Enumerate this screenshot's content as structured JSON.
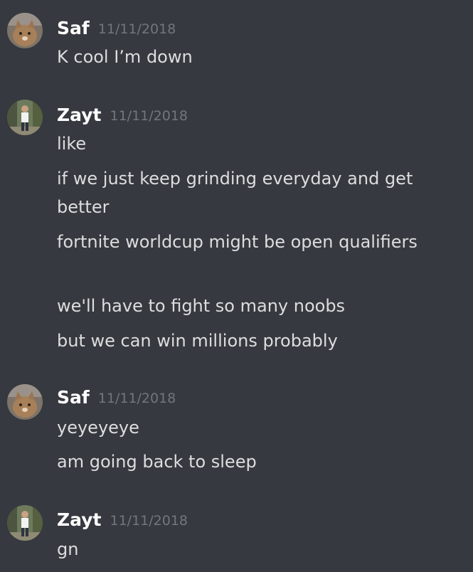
{
  "messages": [
    {
      "author": "Saf",
      "timestamp": "11/11/2018",
      "avatar_icon": "cat-photo-avatar",
      "lines": [
        "K cool I’m down"
      ]
    },
    {
      "author": "Zayt",
      "timestamp": "11/11/2018",
      "avatar_icon": "person-photo-avatar",
      "lines": [
        "like",
        "if we just keep grinding everyday and get better",
        "fortnite worldcup might be open qualifiers",
        "we'll have to fight so many noobs",
        "but we can win millions probably"
      ]
    },
    {
      "author": "Saf",
      "timestamp": "11/11/2018",
      "avatar_icon": "cat-photo-avatar",
      "lines": [
        "yeyeyeye",
        "am going back to sleep"
      ]
    },
    {
      "author": "Zayt",
      "timestamp": "11/11/2018",
      "avatar_icon": "person-photo-avatar",
      "lines": [
        "gn"
      ]
    }
  ],
  "colors": {
    "background": "#36393f",
    "username": "#ffffff",
    "timestamp": "#72767d",
    "message_text": "#dcddde"
  }
}
